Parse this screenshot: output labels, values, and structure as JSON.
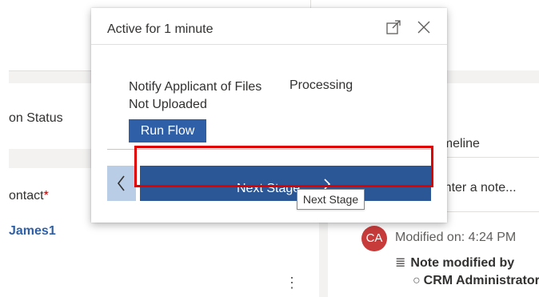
{
  "background": {
    "status_label": "on Status",
    "contact_label": "ontact",
    "required_marker": "*",
    "contact_value": "James1",
    "more_menu": "⋮",
    "timeline_label": "Timeline",
    "note_placeholder": "Enter a note...",
    "timeline_entry": {
      "avatar_initials": "CA",
      "modified_text": "Modified on: 4:24 PM",
      "note_title": "Note modified by",
      "author": "CRM Administrator"
    }
  },
  "flyout": {
    "title": "Active for 1 minute",
    "step_label": "Notify Applicant of Files Not Uploaded",
    "step_label_2": "Processing",
    "run_flow_label": "Run Flow",
    "next_stage_label": "Next Stage",
    "tooltip": "Next Stage"
  },
  "colors": {
    "primary_button": "#2b5797",
    "run_flow": "#2f5fa6",
    "back_button": "#b9cde6",
    "highlight": "#e00000",
    "avatar": "#c73b3b"
  },
  "icons": {
    "expand": "expand-icon",
    "close": "close-icon",
    "back": "chevron-left-icon",
    "next": "chevron-right-icon",
    "note": "note-icon",
    "person": "person-icon"
  }
}
